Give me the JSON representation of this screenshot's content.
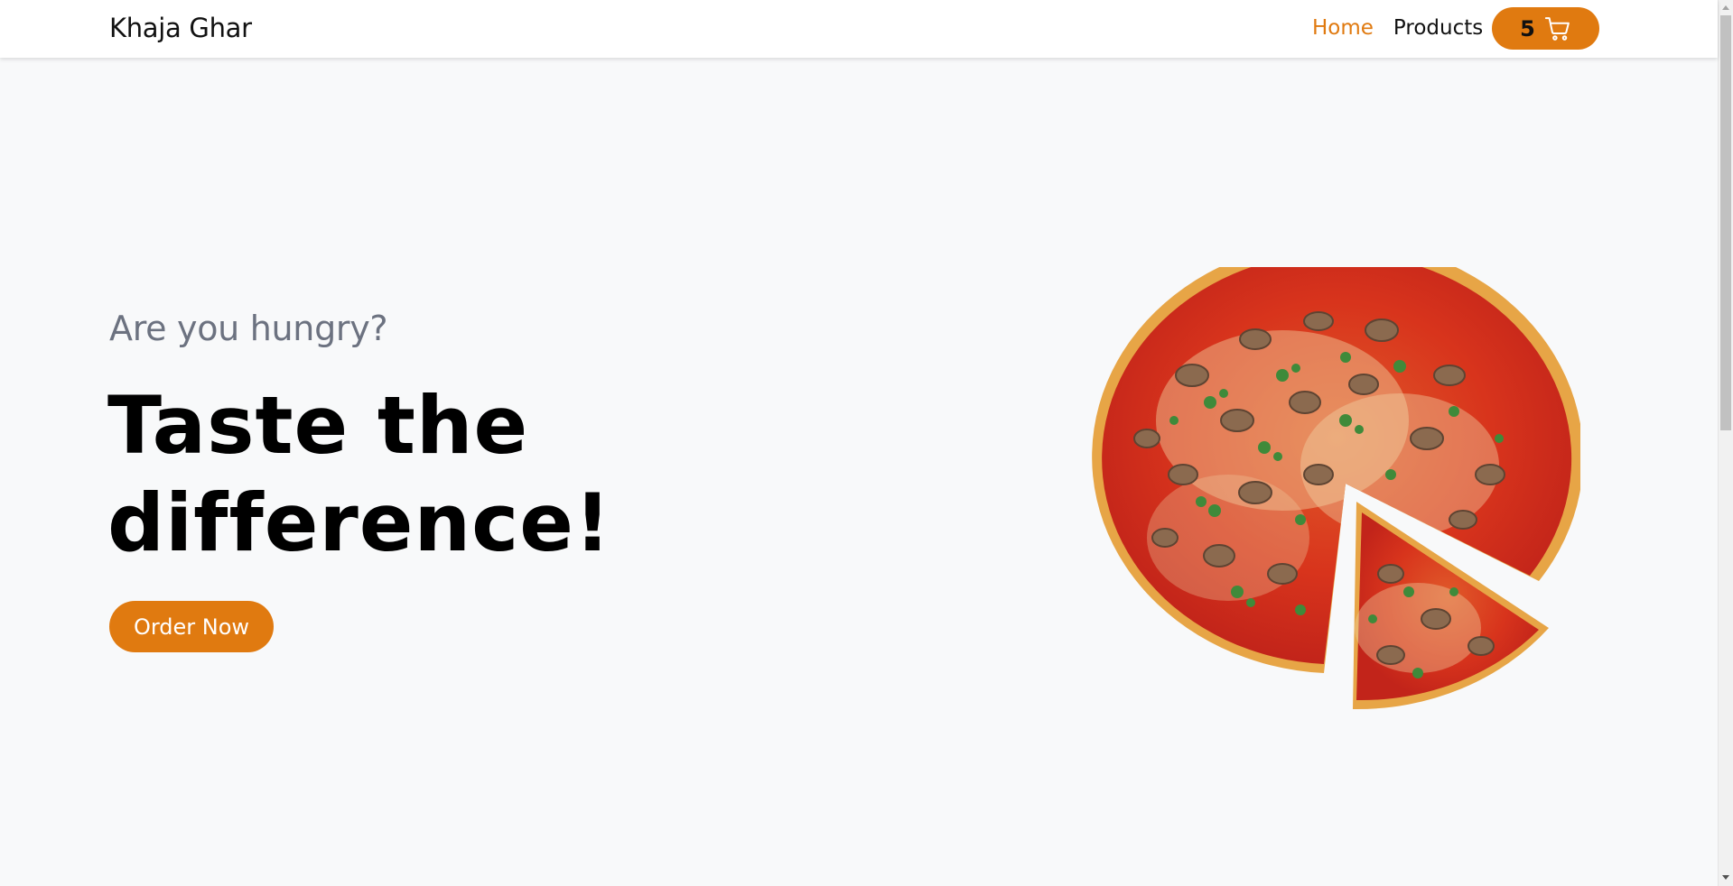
{
  "brand": "Khaja Ghar",
  "nav": {
    "links": [
      {
        "label": "Home",
        "active": true
      },
      {
        "label": "Products",
        "active": false
      }
    ],
    "cart": {
      "count": "5",
      "icon": "cart-icon"
    }
  },
  "hero": {
    "subtitle": "Are you hungry?",
    "title": "Taste the difference!",
    "cta": "Order Now",
    "image": "pizza-image"
  },
  "colors": {
    "accent": "#e07a10",
    "background": "#f8f9fa",
    "subtitle": "#6c7280"
  }
}
